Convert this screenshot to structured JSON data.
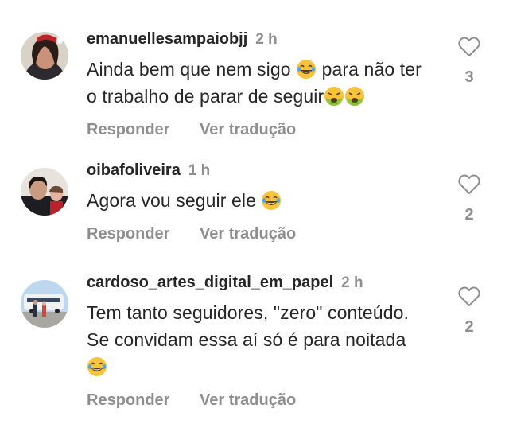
{
  "comments": [
    {
      "username": "emanuellesampaiobjj",
      "time": "2 h",
      "text_parts": [
        "Ainda bem que nem sigo ",
        " para não ter o trabalho de parar de seguir"
      ],
      "emojis": [
        "laughing-emoji",
        "nauseated-emoji",
        "nauseated-emoji"
      ],
      "reply_label": "Responder",
      "translate_label": "Ver tradução",
      "likes": "3"
    },
    {
      "username": "oibafoliveira",
      "time": "1 h",
      "text_parts": [
        "Agora vou seguir ele "
      ],
      "emojis": [
        "laughing-emoji"
      ],
      "reply_label": "Responder",
      "translate_label": "Ver tradução",
      "likes": "2"
    },
    {
      "username": "cardoso_artes_digital_em_papel",
      "time": "2 h",
      "text_parts": [
        "Tem tanto seguidores, \"zero\" conteúdo. Se convidam essa aí só é para noitada"
      ],
      "emojis": [
        "laughing-emoji"
      ],
      "reply_label": "Responder",
      "translate_label": "Ver tradução",
      "likes": "2"
    }
  ],
  "icons": {
    "like": "heart-outline-icon"
  },
  "colors": {
    "text": "#262626",
    "muted": "#8e8e8e"
  }
}
